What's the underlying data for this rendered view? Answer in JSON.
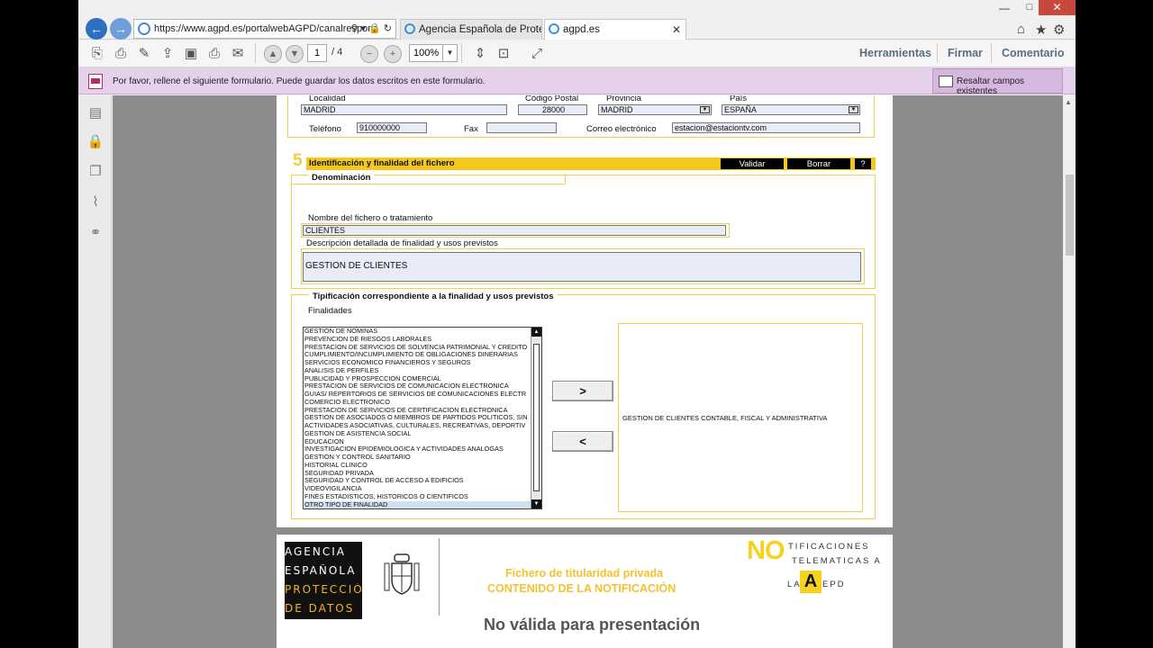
{
  "browser": {
    "address": "https://www.agpd.es/portalwebAGPD/canalrespons",
    "tabs": [
      {
        "label": "Agencia Española de Protecció..."
      },
      {
        "label": "agpd.es"
      }
    ],
    "window_controls": {
      "minimize": "—",
      "maximize": "□",
      "close": "✕"
    },
    "tools": {
      "home": "⌂",
      "favorites": "★",
      "settings": "⚙"
    }
  },
  "pdf_toolbar": {
    "page_current": "1",
    "page_total": "/ 4",
    "zoom": "100%",
    "links": [
      "Herramientas",
      "Firmar",
      "Comentario"
    ]
  },
  "form_bar": {
    "message": "Por favor, rellene el siguiente formulario. Puede guardar los datos escritos en este formulario.",
    "highlight_button": "Resaltar campos existentes"
  },
  "address_section": {
    "localidad_label": "Localidad",
    "localidad": "MADRID",
    "cp_label": "Código Postal",
    "cp": "28000",
    "provincia_label": "Provincia",
    "provincia": "MADRID",
    "pais_label": "País",
    "pais": "ESPAÑA",
    "telefono_label": "Teléfono",
    "telefono": "910000000",
    "fax_label": "Fax",
    "fax": "",
    "email_label": "Correo electrónico",
    "email": "estacion@estaciontv.com"
  },
  "section5": {
    "number": "5",
    "title": "Identificación y finalidad del fichero",
    "validate": "Validar",
    "delete": "Borrar",
    "help": "?",
    "denominacion_label": "Denominación",
    "nombre_label": "Nombre del fichero o tratamiento",
    "nombre": "CLIENTES",
    "descripcion_label": "Descripción detallada de finalidad y usos previstos",
    "descripcion": "GESTION DE CLIENTES",
    "tipificacion_label": "Tipificación correspondiente a la finalidad y usos previstos",
    "finalidades_label": "Finalidades",
    "finalidades": [
      "GESTION DE NOMINAS",
      "PREVENCION DE RIESGOS LABORALES",
      "PRESTACION DE SERVICIOS DE SOLVENCIA PATRIMONIAL Y CREDITO",
      "CUMPLIMIENTO/INCUMPLIMIENTO DE OBLIGACIONES DINERARIAS",
      "SERVICIOS ECONOMICO FINANCIEROS Y SEGUROS",
      "ANALISIS DE PERFILES",
      "PUBLICIDAD Y PROSPECCION COMERCIAL",
      "PRESTACION DE SERVICIOS DE COMUNICACION ELECTRONICA",
      "GUIAS/ REPERTORIOS DE SERVICIOS DE COMUNICACIONES ELECTR",
      "COMERCIO ELECTRONICO",
      "PRESTACION DE SERVICIOS DE CERTIFICACION ELECTRONICA",
      "GESTION DE ASOCIADOS O MIEMBROS DE PARTIDOS POLITICOS, SIN",
      "ACTIVIDADES ASOCIATIVAS, CULTURALES, RECREATIVAS, DEPORTIV",
      "GESTION DE ASISTENCIA SOCIAL",
      "EDUCACION",
      "INVESTIGACION EPIDEMIOLOGICA Y ACTIVIDADES ANALOGAS",
      "GESTION Y CONTROL SANITARIO",
      "HISTORIAL CLINICO",
      "SEGURIDAD PRIVADA",
      "SEGURIDAD Y CONTROL DE ACCESO A EDIFICIOS",
      "VIDEOVIGILANCIA",
      "FINES ESTADISTICOS, HISTORICOS O CIENTIFICOS",
      "OTRO TIPO DE FINALIDAD"
    ],
    "add_button": ">",
    "remove_button": "<",
    "selected_value": "GESTION DE CLIENTES CONTABLE, FISCAL Y ADMINISTRATIVA"
  },
  "page2": {
    "logo_lines": [
      "AGENCIA",
      "ESPAÑOLA DE",
      "PROTECCIÓN",
      "DE DATOS"
    ],
    "title1": "Fichero de titularidad privada",
    "title2": "CONTENIDO DE LA NOTIFICACIÓN",
    "nota_logo": {
      "no": "NO",
      "a": "A",
      "line1": "TIFICACIONES",
      "line2": "TELEMATICAS A",
      "line3": "LA",
      "line4": "EPD"
    },
    "watermark": "No válida para presentación"
  }
}
